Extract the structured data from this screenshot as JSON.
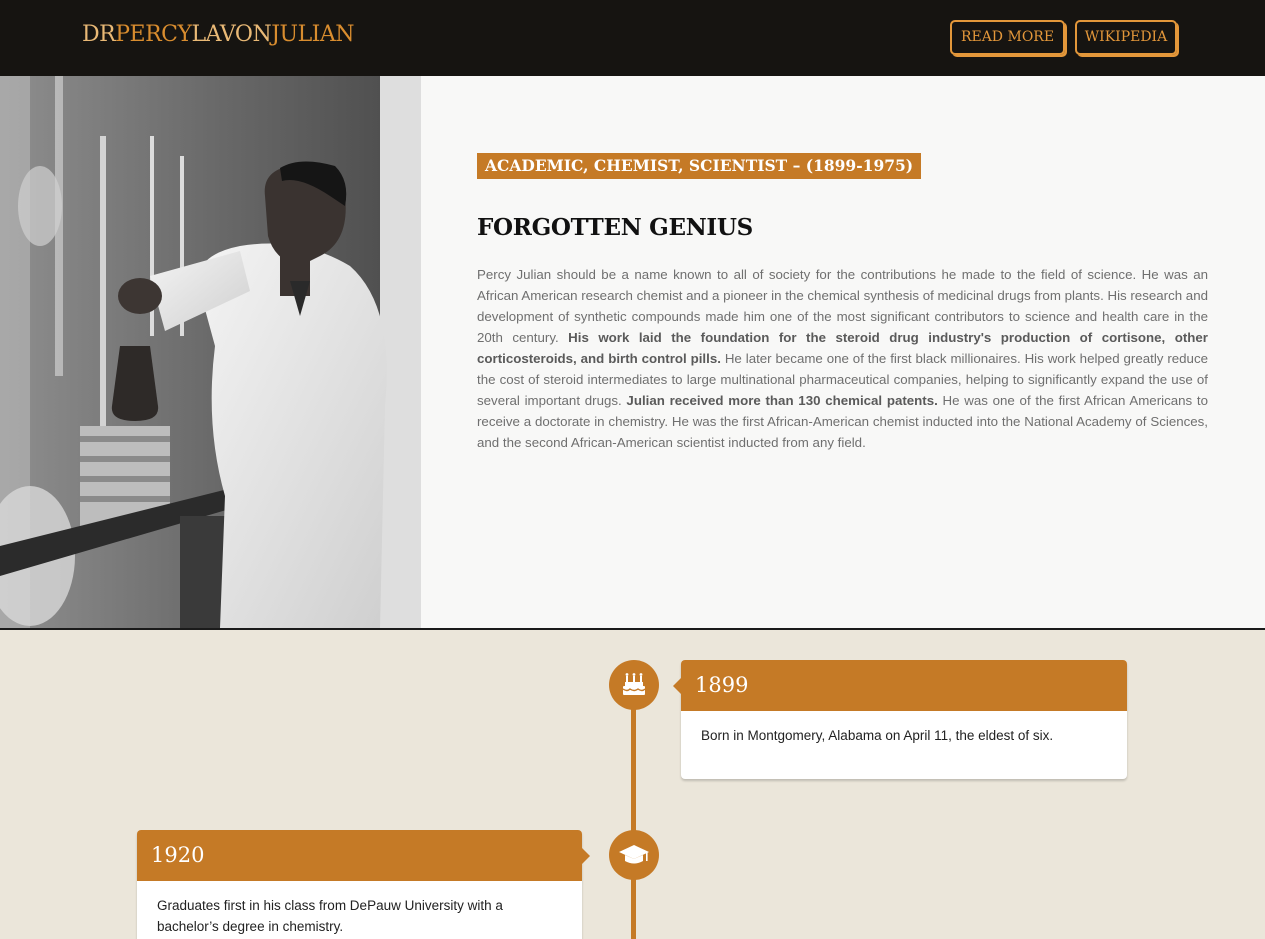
{
  "header": {
    "logo_parts": [
      "DR",
      "PERCY",
      "LAVON",
      "JULIAN"
    ],
    "nav": [
      {
        "label": "READ MORE"
      },
      {
        "label": "WIKIPEDIA"
      }
    ]
  },
  "hero": {
    "tagline": "ACADEMIC, CHEMIST, SCIENTIST – (1899-1975)",
    "title": "FORGOTTEN GENIUS",
    "bio": [
      {
        "text": "Percy Julian should be a name known to all of society for the contributions he made to the field of science. He was an African American research chemist and a pioneer in the chemical synthesis of medicinal drugs from plants. His research and development of synthetic compounds made him one of the most significant contributors to science and health care in the 20th century. ",
        "bold": false
      },
      {
        "text": "His work laid the foundation for the steroid drug industry's production of cortisone, other corticosteroids, and birth control pills.",
        "bold": true
      },
      {
        "text": " He later became one of the first black millionaires. His work helped greatly reduce the cost of steroid intermediates to large multinational pharmaceutical companies, helping to significantly expand the use of several important drugs. ",
        "bold": false
      },
      {
        "text": "Julian received more than 130 chemical patents.",
        "bold": true
      },
      {
        "text": " He was one of the first African Americans to receive a doctorate in chemistry. He was the first African-American chemist inducted into the National Academy of Sciences, and the second African-American scientist inducted from any field.",
        "bold": false
      }
    ]
  },
  "timeline": [
    {
      "year": "1899",
      "icon": "birthday-cake-icon",
      "text": "Born in Montgomery, Alabama on April 11, the eldest of six."
    },
    {
      "year": "1920",
      "icon": "graduation-cap-icon",
      "text": "Graduates first in his class from DePauw University with a bachelor’s degree in chemistry."
    }
  ],
  "colors": {
    "accent": "#c57a26",
    "header_bg": "#161411",
    "timeline_bg": "#ebe6da"
  }
}
